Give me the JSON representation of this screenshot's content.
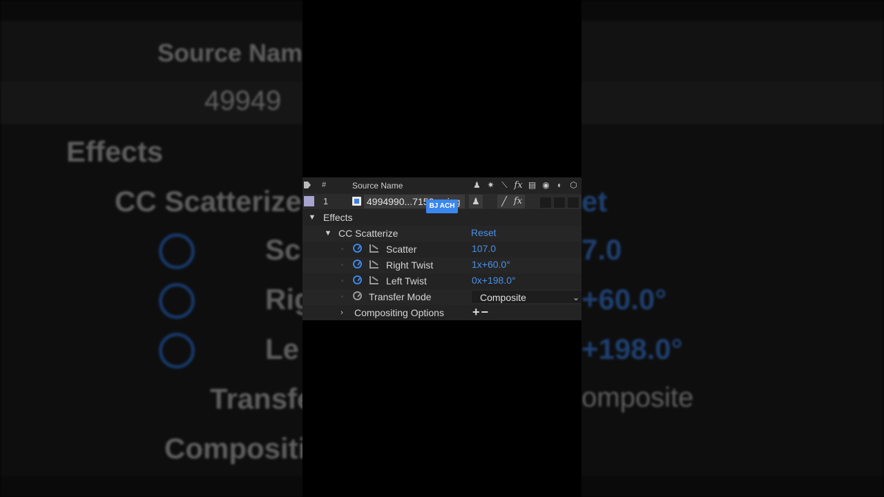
{
  "header": {
    "number_col": "#",
    "source_name_col": "Source Name",
    "switch_icons": [
      "shy-icon",
      "collapse-icon",
      "quality-icon",
      "fx-icon",
      "frame-blend-icon",
      "motion-blur-icon",
      "adjustment-icon",
      "3d-icon"
    ]
  },
  "layer": {
    "number": "1",
    "name": "4994990...7152_n.jpg",
    "label_color": "#a7a4d0",
    "fx_label": "fx"
  },
  "effects": {
    "group_label": "Effects",
    "effect_name": "CC Scatterize",
    "reset_label": "Reset",
    "properties": [
      {
        "label": "Scatter",
        "value": "107.0"
      },
      {
        "label": "Right Twist",
        "value": "1x+60.0°"
      },
      {
        "label": "Left Twist",
        "value": "0x+198.0°"
      }
    ],
    "transfer_mode": {
      "label": "Transfer Mode",
      "value": "Composite"
    },
    "compositing_options": {
      "label": "Compositing Options",
      "buttons": "+−"
    }
  },
  "watermark": "BJ ACH",
  "background_zoom": {
    "source_name_fragment": "Source Nam",
    "layer_name_fragment": "49949",
    "effects": "Effects",
    "effect_fragment": "CC Scatterize",
    "reset_fragment": "et",
    "scatter_fragment": "Sc",
    "scatter_value_fragment": "7.0",
    "right_fragment": "Rig",
    "right_value_fragment": "+60.0°",
    "left_fragment": "Le",
    "left_value_fragment": "+198.0°",
    "transfer_fragment": "Transfe",
    "composite_fragment": "omposite",
    "compositing_fragment": "Compositi"
  },
  "colors": {
    "accent_blue": "#4a90e8",
    "panel_bg": "#232323"
  }
}
